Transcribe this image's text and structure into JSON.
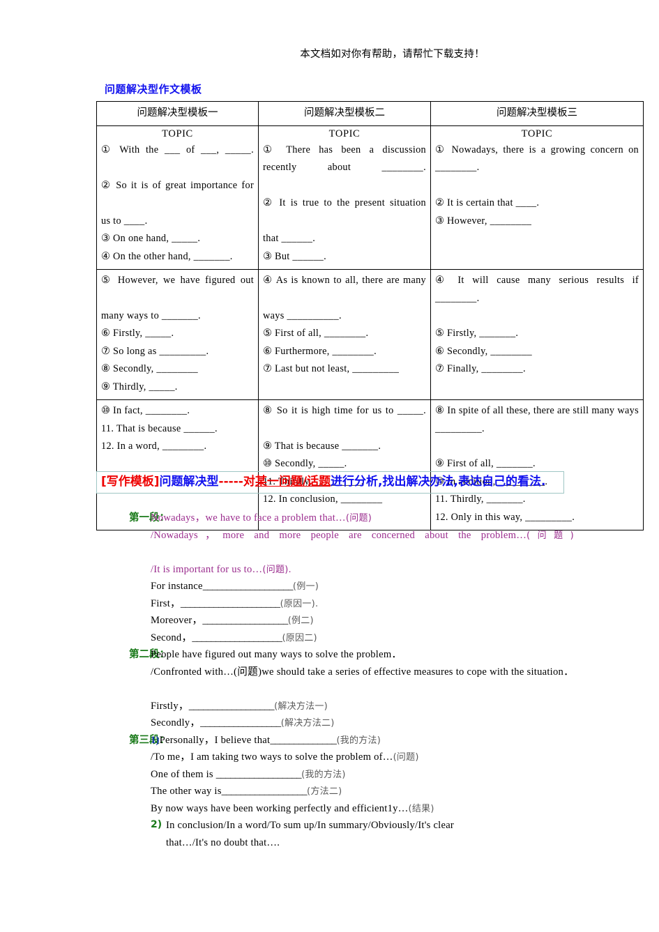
{
  "banner": {
    "text": "本文档如对你有帮助，请帮忙下载支持！"
  },
  "doc": {
    "heading": "问题解决型作文模板"
  },
  "table": {
    "headers": [
      "问题解决型模板一",
      "问题解决型模板二",
      "问题解决型模板三"
    ],
    "topic_label": "TOPIC",
    "rows": [
      {
        "col1": [
          "① With the ___ of ___, _____.",
          "② So it is of great importance for",
          "us to ____.",
          "③ On one hand, _____.",
          "④ On the other hand, _______."
        ],
        "col2": [
          "① There has been a discussion recently about ________.",
          "② It is true to the present situation",
          "that ______.",
          "③ But ______."
        ],
        "col3": [
          "① Nowadays, there is a growing concern on ________.",
          "② It is certain that ____.",
          "③ However, ________"
        ]
      },
      {
        "col1": [
          "⑤ However, we have figured out",
          "many ways to _______.",
          "⑥ Firstly, _____.",
          "⑦ So long as _________.",
          "⑧ Secondly, ________",
          "⑨ Thirdly, _____."
        ],
        "col2": [
          "④ As is known to all, there are many",
          "ways __________.",
          "⑤ First of all, ________.",
          "⑥ Furthermore, ________.",
          "⑦ Last but not least, _________"
        ],
        "col3": [
          "④ It will cause many serious results if ________.",
          "⑤ Firstly, _______.",
          "⑥ Secondly, ________",
          "⑦ Finally, ________."
        ]
      },
      {
        "col1": [
          "⑩ In fact, ________.",
          "11. That is because ______.",
          "12. In a word, ________."
        ],
        "col2": [
          "⑧ So it is high time for us to _____.",
          "⑨ That is because _______.",
          "⑩ Secondly, _____.",
          "11. Thirdly, _________.",
          "12. In conclusion, ________"
        ],
        "col3": [
          "⑧ In spite of all these, there are still many ways _________.",
          "⑨ First of all, _______.",
          "⑩ In addition, _________.",
          "11. Thirdly, _______.",
          "12. Only in this way, _________."
        ]
      }
    ]
  },
  "callout": {
    "tag": "[写作模板]",
    "type_cn": "问题解决型",
    "dashes": "-----对",
    "underlined": "某一问题/话题",
    "rest": "进行分析,找出解决办法,表达自己的看法."
  },
  "paragraphs": [
    {
      "label": "第一段：",
      "lines": [
        {
          "en": "Nowadays，we have to face a problem that…",
          "cn": "(问题)",
          "style": "purple"
        },
        {
          "en": "/Nowadays，more and more people are concerned about the problem…",
          "cn": "(问题)",
          "style": "purple-justify"
        },
        {
          "en": "/It is important for us to…",
          "cn": "(问题).",
          "style": "purple"
        },
        {
          "en": "For instance",
          "blank": "___________________",
          "cn": "(例一)",
          "style": "plain"
        },
        {
          "en": "First，",
          "blank": "_____________________",
          "cn": "(原因一).",
          "style": "plain"
        },
        {
          "en": "Moreover，",
          "blank": "__________________",
          "cn": "(例二)",
          "style": "plain"
        },
        {
          "en": "Second，",
          "blank": "___________________",
          "cn": "(原因二)",
          "style": "plain"
        }
      ]
    },
    {
      "label": "第二段：",
      "lines": [
        {
          "en": "People have figured out many ways to solve the problem．",
          "cn": "",
          "style": "plain"
        },
        {
          "en": "/Confronted with…(问题)we should take a series of effective measures to cope with the situation．",
          "cn": "",
          "style": "plain-justify"
        },
        {
          "en": "Firstly，",
          "blank": "__________________",
          "cn": "(解决方法一)",
          "style": "plain"
        },
        {
          "en": "Secondly，",
          "blank": "_________________",
          "cn": "(解决方法二)",
          "style": "plain"
        }
      ]
    },
    {
      "label": "第三段：",
      "marker1": "1)",
      "marker2": "2)",
      "lines": [
        {
          "en": "Personally，I believe that",
          "blank": "______________",
          "cn": "(我的方法)",
          "style": "plain"
        },
        {
          "en": "/To me，I am taking two ways to solve the problem of…",
          "cn": "(问题)",
          "style": "plain"
        },
        {
          "en": "One of them is ",
          "blank": "__________________",
          "cn": "(我的方法)",
          "style": "plain"
        },
        {
          "en": "The other way is",
          "blank": "__________________",
          "cn": "(方法二)",
          "style": "plain"
        },
        {
          "en": "By now ways have been working perfectly and efficient1y…",
          "cn": "(结果)",
          "style": "plain"
        }
      ],
      "last_lines": [
        "In conclusion/In a word/To sum up/In summary/Obviously/It's clear",
        "that…/It's no doubt that…."
      ]
    }
  ]
}
